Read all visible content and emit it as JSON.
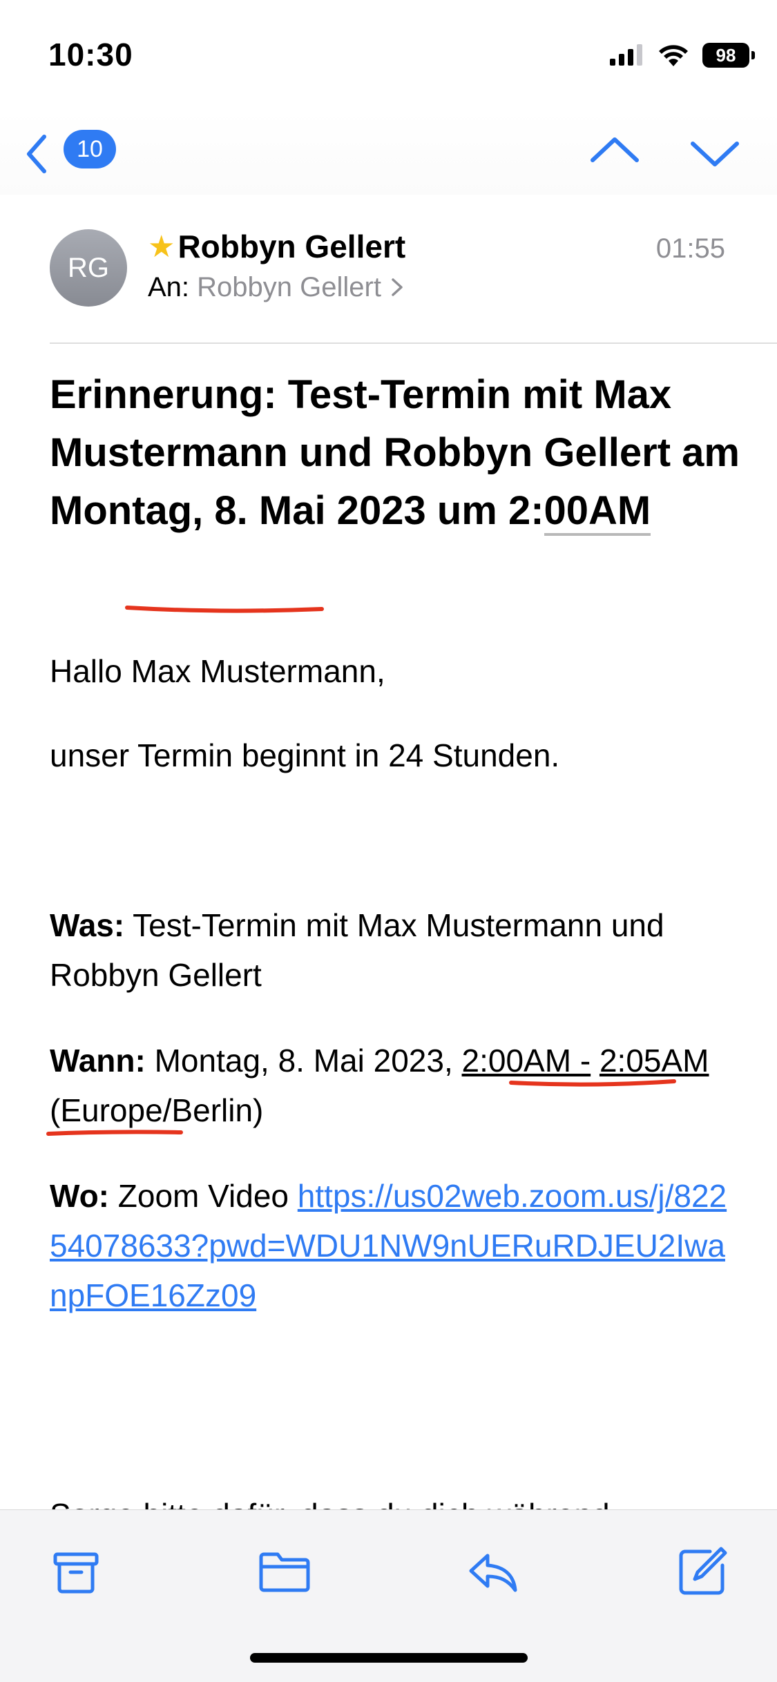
{
  "status": {
    "time": "10:30",
    "battery": "98"
  },
  "nav": {
    "unread_count": "10"
  },
  "message": {
    "sender": "Robbyn Gellert",
    "avatar_initials": "RG",
    "to_label": "An:",
    "recipient": "Robbyn Gellert",
    "time": "01:55",
    "subject_pre": "Erinnerung: Test-Termin mit Max Mustermann und Robbyn Gellert am Montag, 8. Mai 2023 um ",
    "subject_time_a": "2:",
    "subject_time_b": "00AM"
  },
  "body": {
    "greeting": "Hallo Max Mustermann,",
    "intro": "unser Termin beginnt in 24 Stunden.",
    "was_label": "Was:",
    "was_value": " Test-Termin mit Max Mustermann und Robbyn Gellert",
    "wann_label": "Wann:",
    "wann_pre": " Montag, 8. Mai 2023, ",
    "wann_range_a": "2:00AM -",
    "wann_range_b": "2:05AM",
    "wann_tz": " (Europe/Berlin)",
    "wo_label": "Wo:",
    "wo_pre": " Zoom Video ",
    "wo_link": "https://us02web.zoom.us/j/82254078633?pwd=WDU1NW9nUERuRDJEU2IwanpFOE16Zz09",
    "cut_line": "Sorge bitte dafür, dass du dich während"
  },
  "colors": {
    "accent": "#2f7bf3",
    "star": "#f7c21a",
    "annotation": "#e5341d"
  }
}
